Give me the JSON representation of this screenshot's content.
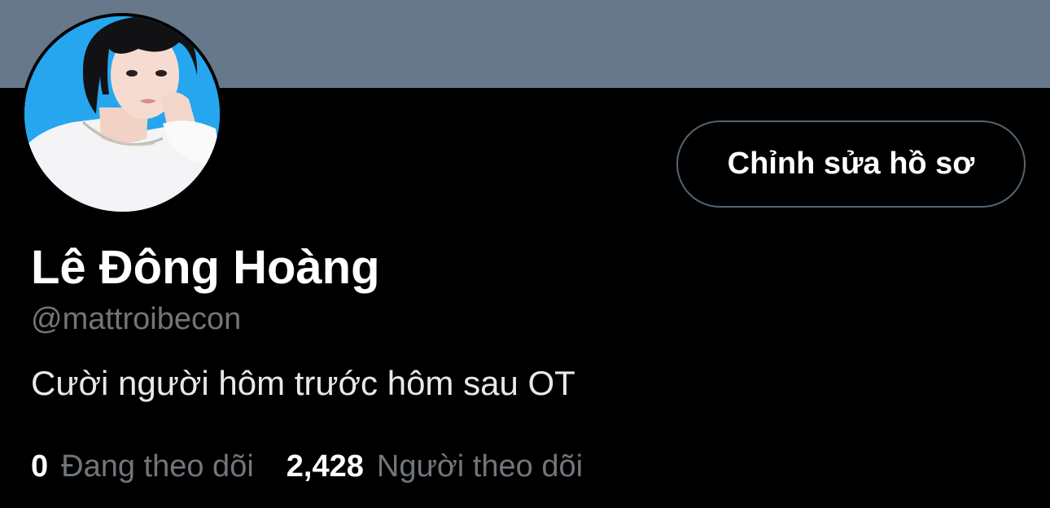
{
  "profile": {
    "display_name": "Lê Đông Hoàng",
    "handle": "@mattroibecon",
    "bio": "Cười người hôm trước hôm sau OT",
    "edit_profile_label": "Chỉnh sửa hồ sơ"
  },
  "stats": {
    "following": {
      "count": "0",
      "label": "Đang theo dõi"
    },
    "followers": {
      "count": "2,428",
      "label": "Người theo dõi"
    }
  },
  "colors": {
    "banner": "#66788a",
    "background": "#000000",
    "secondary_text": "#71767b",
    "button_border": "#536471",
    "avatar_background": "#26a6ef"
  }
}
